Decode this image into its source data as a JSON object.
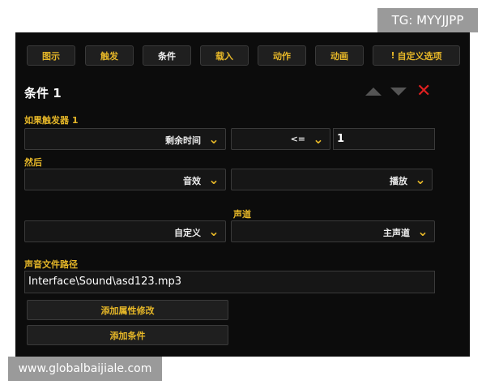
{
  "watermark_top": "TG: MYYJJPP",
  "watermark_bottom": "www.globalbaijiale.com",
  "tabs": [
    {
      "label": "图示"
    },
    {
      "label": "触发"
    },
    {
      "label": "条件"
    },
    {
      "label": "载入"
    },
    {
      "label": "动作"
    },
    {
      "label": "动画"
    },
    {
      "label": "自定义选项",
      "icon": "exclamation-icon"
    }
  ],
  "active_tab": "条件",
  "panel_title": "条件 1",
  "if_trigger_label": "如果触发器 1",
  "row1": {
    "left_value": "剩余时间",
    "operator": "<=",
    "number": "1"
  },
  "then_label": "然后",
  "row2": {
    "left_value": "音效",
    "right_value": "播放"
  },
  "channel_label": "声道",
  "row3": {
    "left_value": "自定义",
    "right_value": "主声道"
  },
  "sound_path_label": "声音文件路径",
  "sound_path": "Interface\\Sound\\asd123.mp3",
  "buttons": {
    "add_property": "添加属性修改",
    "add_condition": "添加条件"
  },
  "colors": {
    "accent": "#e6b728",
    "panel_bg": "#0c0c0c",
    "close": "#e02020"
  }
}
